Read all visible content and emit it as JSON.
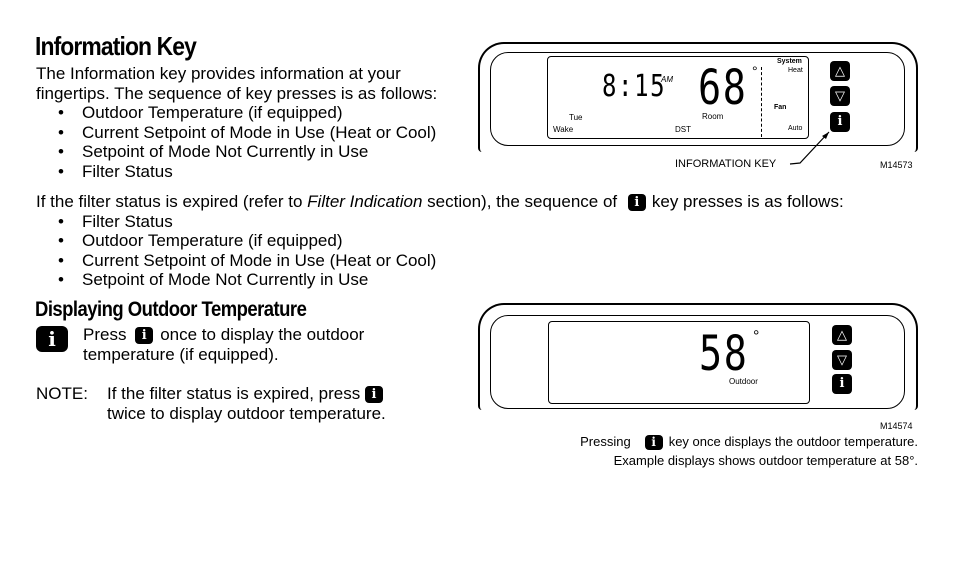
{
  "title": "Information Key",
  "intro": [
    "The Information key provides information at your",
    "fingertips. The sequence of key presses is as follows:"
  ],
  "sequence": [
    "Outdoor Temperature (if equipped)",
    "Current Setpoint of Mode in Use (Heat or Cool)",
    "Setpoint of Mode Not Currently in Use",
    "Filter Status"
  ],
  "expired_text": {
    "before": "If the filter status is expired (refer to ",
    "italic": "Filter Indication",
    "after": " section), the sequence of",
    "after2": "key presses is as follows:"
  },
  "expired_sequence": [
    "Filter Status",
    "Outdoor Temperature (if equipped)",
    "Current Setpoint of Mode in Use (Heat or Cool)",
    "Setpoint of Mode Not Currently in Use"
  ],
  "section2": {
    "title": "Displaying Outdoor Temperature",
    "press": "Press",
    "press_after": "once to display the outdoor",
    "press_line2": "temperature (if equipped).",
    "note_label": "NOTE:",
    "note_line1": "If the filter status is expired, press",
    "note_line2": "twice to display outdoor temperature."
  },
  "icon_letter": "i",
  "figure1": {
    "time": "8:15",
    "ampm": "AM",
    "temp": "68",
    "degree": "°",
    "system": "System",
    "heat": "Heat",
    "fan": "Fan",
    "auto": "Auto",
    "day": "Tue",
    "period": "Wake",
    "room": "Room",
    "dst": "DST",
    "callout": "INFORMATION KEY",
    "code": "M14573",
    "up": "△",
    "down": "▽"
  },
  "figure2": {
    "temp": "58",
    "degree": "°",
    "outdoor": "Outdoor",
    "code": "M14574",
    "caption_pre": "Pressing",
    "caption_post": "key once displays the outdoor temperature.",
    "caption2": "Example displays shows outdoor temperature at 58°."
  }
}
